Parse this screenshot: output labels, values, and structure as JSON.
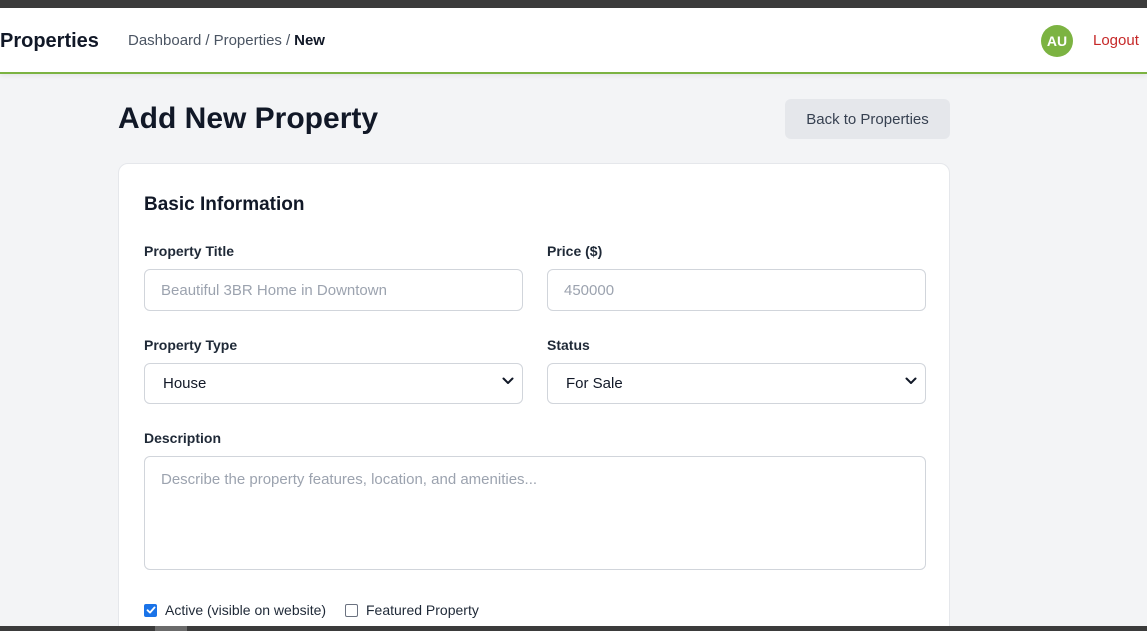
{
  "header": {
    "brand": "Properties",
    "breadcrumb": {
      "home": "Dashboard",
      "parent": "Properties",
      "current": "New",
      "separator": "/"
    },
    "avatar_initials": "AU",
    "logout_label": "Logout"
  },
  "page": {
    "title": "Add New Property",
    "back_button": "Back to Properties"
  },
  "form": {
    "section_title": "Basic Information",
    "title_label": "Property Title",
    "title_placeholder": "Beautiful 3BR Home in Downtown",
    "price_label": "Price ($)",
    "price_placeholder": "450000",
    "type_label": "Property Type",
    "type_value": "House",
    "status_label": "Status",
    "status_value": "For Sale",
    "description_label": "Description",
    "description_placeholder": "Describe the property features, location, and amenities...",
    "active_label": "Active (visible on website)",
    "active_checked": true,
    "featured_label": "Featured Property",
    "featured_checked": false
  },
  "colors": {
    "accent_green": "#7cb342",
    "logout_red": "#c62828",
    "checkbox_blue": "#1a73e8"
  }
}
